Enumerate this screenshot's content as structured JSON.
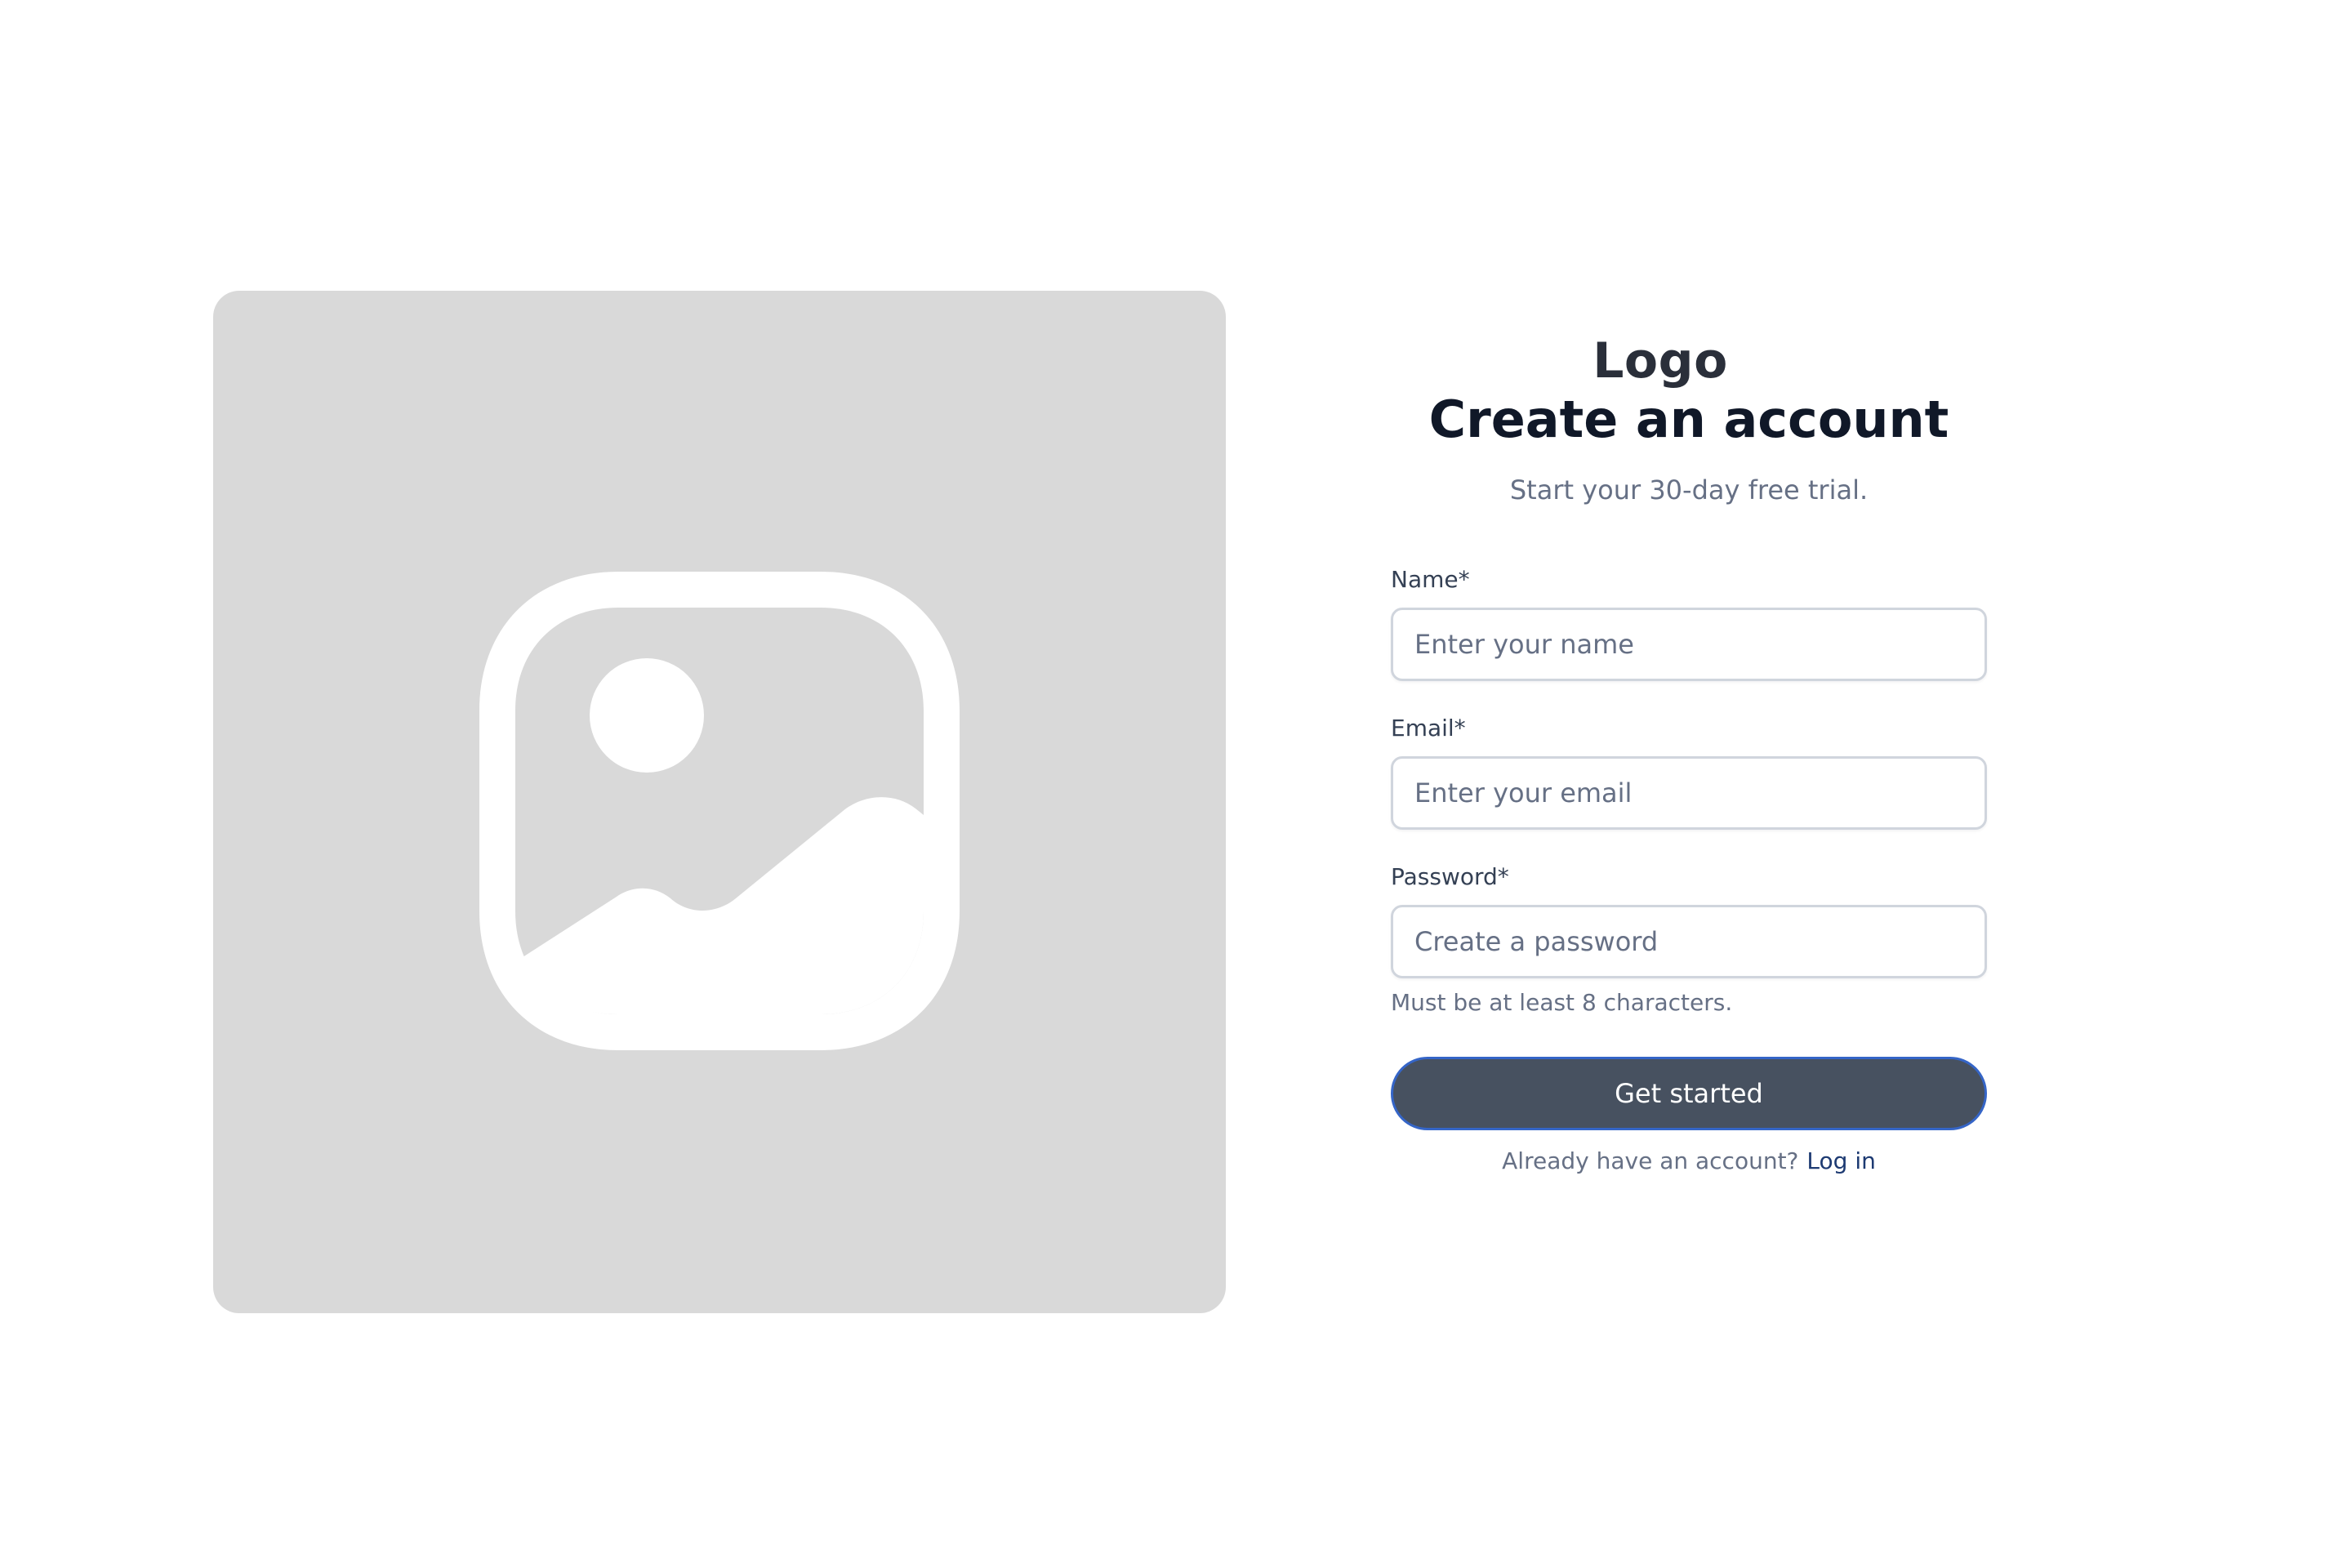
{
  "image_placeholder": {
    "icon": "image-icon"
  },
  "header": {
    "logo": "Logo",
    "title": "Create an account",
    "subtitle": "Start your 30-day free trial."
  },
  "form": {
    "name": {
      "label": "Name*",
      "placeholder": "Enter your name",
      "value": ""
    },
    "email": {
      "label": "Email*",
      "placeholder": "Enter your email",
      "value": ""
    },
    "password": {
      "label": "Password*",
      "placeholder": "Create a password",
      "value": "",
      "hint": "Must be at least 8 characters."
    },
    "submit_label": "Get started"
  },
  "footer": {
    "prompt": "Already have an account?",
    "login_link": "Log in"
  },
  "colors": {
    "button_bg": "#475160",
    "button_border": "#3565c7",
    "link": "#1d3a72",
    "placeholder_panel": "#d9d9d9"
  }
}
